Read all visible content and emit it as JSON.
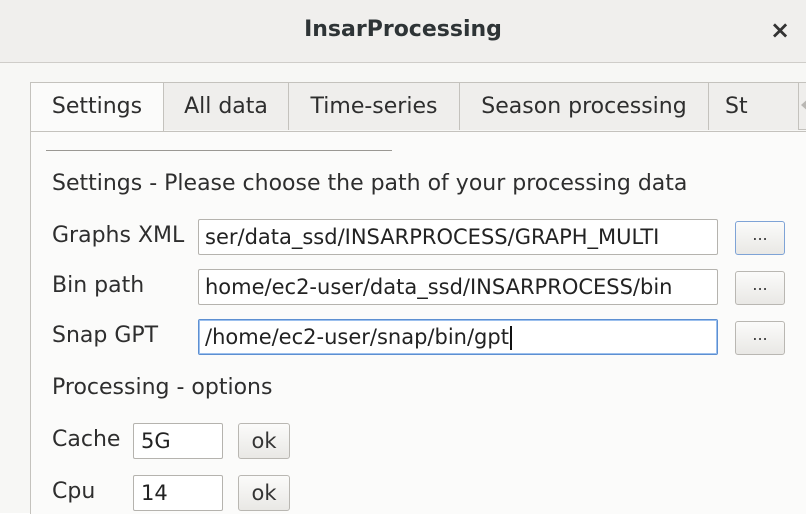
{
  "window": {
    "title": "InsarProcessing",
    "close_glyph": "×"
  },
  "tabs": [
    {
      "label": "Settings"
    },
    {
      "label": "All data"
    },
    {
      "label": "Time-series"
    },
    {
      "label": "Season processing"
    },
    {
      "label": "St"
    }
  ],
  "settings": {
    "section_title": "Settings - Please choose the path of your processing data",
    "graphs_xml": {
      "label": "Graphs XML",
      "value": "ser/data_ssd/INSARPROCESS/GRAPH_MULTI",
      "browse": "..."
    },
    "bin_path": {
      "label": "Bin path",
      "value": "home/ec2-user/data_ssd/INSARPROCESS/bin",
      "browse": "..."
    },
    "snap_gpt": {
      "label": "Snap GPT",
      "value": "/home/ec2-user/snap/bin/gpt",
      "browse": "..."
    }
  },
  "processing": {
    "section_title": "Processing - options",
    "cache": {
      "label": "Cache",
      "value": "5G",
      "ok": "ok"
    },
    "cpu": {
      "label": "Cpu",
      "value": "14",
      "ok": "ok"
    }
  },
  "icons": {
    "tab_scroll_left": "chevron-left-icon",
    "tab_scroll_right": "chevron-right-icon"
  }
}
